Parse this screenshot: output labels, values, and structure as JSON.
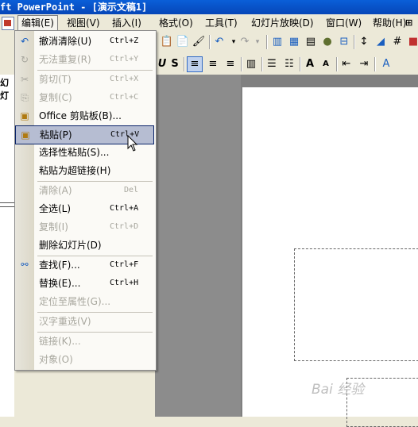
{
  "window": {
    "title": "ft PowerPoint - [演示文稿1]"
  },
  "menubar": {
    "items": [
      {
        "label": "编辑(E)",
        "active": true
      },
      {
        "label": "视图(V)"
      },
      {
        "label": "插入(I)"
      },
      {
        "label": "格式(O)"
      },
      {
        "label": "工具(T)"
      },
      {
        "label": "幻灯片放映(D)"
      },
      {
        "label": "窗口(W)"
      },
      {
        "label": "帮助(H)"
      }
    ],
    "mdi_icon": "⊞"
  },
  "left_panel": {
    "tab_label": "幻灯"
  },
  "edit_menu": {
    "items": [
      {
        "label": "撤消清除(U)",
        "shortcut": "Ctrl+Z",
        "icon": "undo-icon",
        "glyph": "↶",
        "disabled": false
      },
      {
        "label": "无法重复(R)",
        "shortcut": "Ctrl+Y",
        "icon": "redo-icon",
        "glyph": "↻",
        "disabled": true
      },
      {
        "label": "剪切(T)",
        "shortcut": "Ctrl+X",
        "icon": "cut-icon",
        "glyph": "✂",
        "disabled": true
      },
      {
        "label": "复制(C)",
        "shortcut": "Ctrl+C",
        "icon": "copy-icon",
        "glyph": "⎘",
        "disabled": true
      },
      {
        "label": "Office 剪贴板(B)...",
        "shortcut": "",
        "icon": "clipboard-icon",
        "glyph": "📋",
        "disabled": false
      },
      {
        "label": "粘贴(P)",
        "shortcut": "Ctrl+V",
        "icon": "paste-icon",
        "glyph": "📋",
        "disabled": false,
        "hover": true
      },
      {
        "label": "选择性粘贴(S)...",
        "shortcut": "",
        "disabled": false
      },
      {
        "label": "粘贴为超链接(H)",
        "shortcut": "",
        "disabled": false
      },
      {
        "label": "清除(A)",
        "shortcut": "Del",
        "disabled": true
      },
      {
        "label": "全选(L)",
        "shortcut": "Ctrl+A",
        "disabled": false
      },
      {
        "label": "复制(I)",
        "shortcut": "Ctrl+D",
        "disabled": true
      },
      {
        "label": "删除幻灯片(D)",
        "shortcut": "",
        "disabled": false
      },
      {
        "label": "查找(F)...",
        "shortcut": "Ctrl+F",
        "icon": "find-icon",
        "glyph": "🔍",
        "disabled": false
      },
      {
        "label": "替换(E)...",
        "shortcut": "Ctrl+H",
        "disabled": false
      },
      {
        "label": "定位至属性(G)...",
        "shortcut": "",
        "disabled": true
      },
      {
        "label": "汉字重选(V)",
        "shortcut": "",
        "disabled": true
      },
      {
        "label": "链接(K)...",
        "shortcut": "",
        "disabled": true
      },
      {
        "label": "对象(O)",
        "shortcut": "",
        "disabled": true
      }
    ]
  },
  "watermark": "Bai 经验"
}
